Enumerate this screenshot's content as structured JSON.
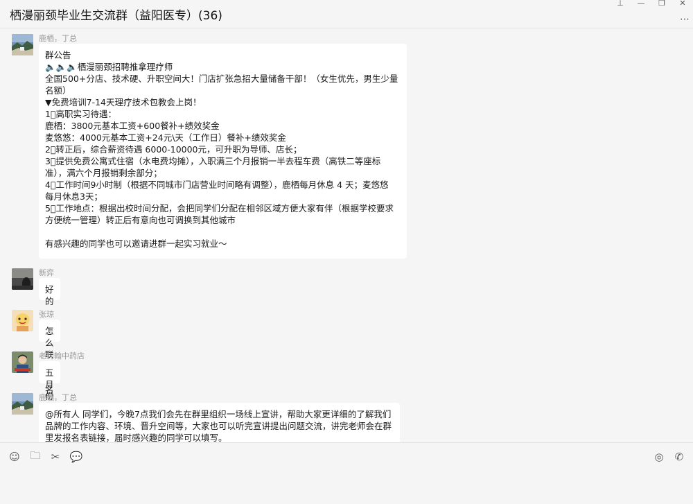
{
  "window": {
    "title": "栖漫丽颈毕业生交流群（益阳医专）(36)",
    "pin_glyph": "⊥",
    "min_glyph": "—",
    "max_glyph": "❐",
    "close_glyph": "✕",
    "more_glyph": "⋯"
  },
  "messages": [
    {
      "sender": "鹿栖，丁总",
      "avatar": "landscape-avatar",
      "text": "群公告\n🔈🔈🔈栖漫丽颈招聘推拿理疗师\n全国500+分店、技术硬、升职空间大！门店扩张急招大量储备干部！（女生优先，男生少量\n名额）\n▼免费培训7-14天理疗技术包教会上岗！\n1⃣高职实习待遇：\n鹿栖：3800元基本工资+600餐补+绩效奖金\n麦悠悠：4000元基本工资+24元\\天（工作日）餐补+绩效奖金\n2⃣转正后，综合薪资待遇 6000-10000元，可升职为导师、店长；\n3⃣提供免费公寓式住宿（水电费均摊），入职满三个月报销一半去程车费（高铁二等座标\n准），满六个月报销剩余部分；\n4⃣工作时间9小时制（根据不同城市门店营业时间略有调整），鹿栖每月休息 4 天；麦悠悠\n每月休息3天；\n5⃣工作地点：根据出校时间分配，会把同学们分配在相邻区域方便大家有伴（根据学校要求\n方便统一管理）转正后有意向也可调换到其他城市\n\n有感兴趣的同学也可以邀请进群一起实习就业～"
    },
    {
      "sender": "新弈",
      "avatar": "dark-scene-avatar",
      "text": "好的"
    },
    {
      "sender": "张琼",
      "avatar": "cartoon-avatar",
      "text": "怎么联系报名"
    },
    {
      "sender": "老约翰中药店",
      "avatar": "person-avatar",
      "text": "五月份去实习的也能去吗@王尔"
    },
    {
      "sender": "鹿栖，丁总",
      "avatar": "landscape-avatar",
      "text": "@所有人 同学们，今晚7点我们会先在群里组织一场线上宣讲，帮助大家更详细的了解我们\n品牌的工作内容、环境、晋升空间等，大家也可以听完宣讲提出问题交流，讲完老师会在群\n里发报名表链接，届时感兴趣的同学可以填写。"
    }
  ],
  "toolbar": {
    "emoji_icon": "☺",
    "folder_icon": "🗀",
    "scissors_icon": "✂",
    "chat_icon": "💬",
    "live_icon": "◎",
    "call_icon": "✆"
  },
  "colors": {
    "bubble": "#ffffff",
    "background": "#f5f5f5",
    "sender": "#9a9a9a"
  }
}
